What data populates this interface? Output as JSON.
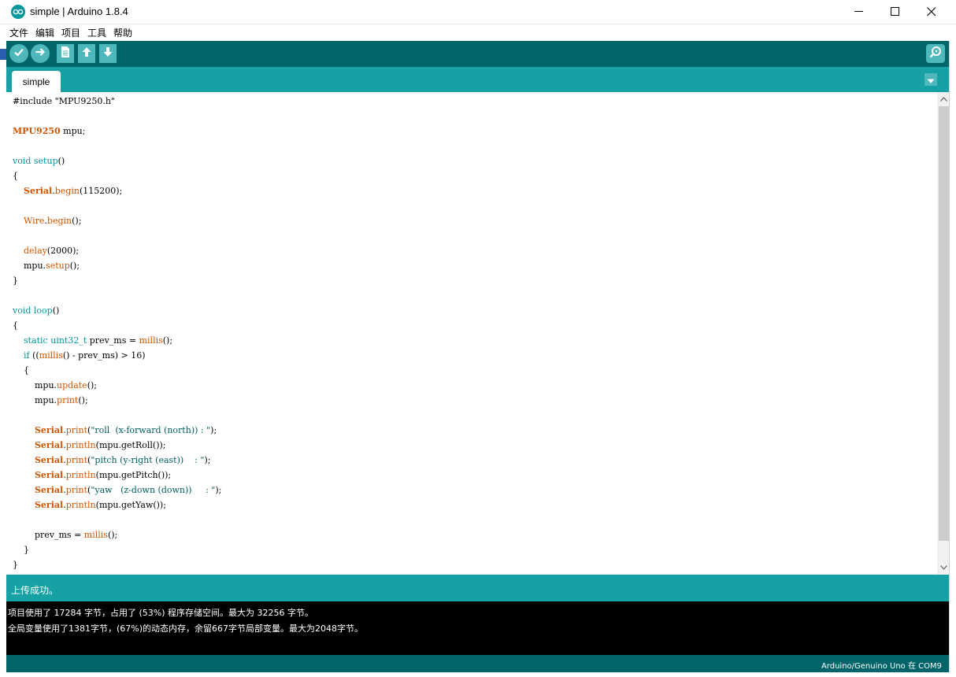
{
  "window": {
    "title": "simple | Arduino 1.8.4"
  },
  "menu": [
    "文件",
    "编辑",
    "项目",
    "工具",
    "帮助"
  ],
  "toolbar": {
    "buttons": [
      "verify-icon",
      "upload-icon",
      "new-icon",
      "open-icon",
      "save-icon"
    ],
    "serial_monitor": "serial-monitor-icon"
  },
  "tabs": [
    "simple"
  ],
  "editor": {
    "lines": [
      [
        [
          "c-pp",
          "#include \"MPU9250.h\""
        ]
      ],
      [],
      [
        [
          "c-cls",
          "MPU9250"
        ],
        [
          "",
          " mpu;"
        ]
      ],
      [],
      [
        [
          "c-kw",
          "void"
        ],
        [
          "",
          " "
        ],
        [
          "c-kw",
          "setup"
        ],
        [
          "",
          "()"
        ]
      ],
      [
        [
          "",
          "{"
        ]
      ],
      [
        [
          "",
          "    "
        ],
        [
          "c-cls",
          "Serial"
        ],
        [
          "",
          "."
        ],
        [
          "c-fn",
          "begin"
        ],
        [
          "",
          "(115200);"
        ]
      ],
      [],
      [
        [
          "",
          "    "
        ],
        [
          "c-fn",
          "Wire"
        ],
        [
          "",
          "."
        ],
        [
          "c-fn",
          "begin"
        ],
        [
          "",
          "();"
        ]
      ],
      [],
      [
        [
          "",
          "    "
        ],
        [
          "c-fn",
          "delay"
        ],
        [
          "",
          "(2000);"
        ]
      ],
      [
        [
          "",
          "    mpu."
        ],
        [
          "c-fn",
          "setup"
        ],
        [
          "",
          "();"
        ]
      ],
      [
        [
          "",
          "}"
        ]
      ],
      [],
      [
        [
          "c-kw",
          "void"
        ],
        [
          "",
          " "
        ],
        [
          "c-kw",
          "loop"
        ],
        [
          "",
          "()"
        ]
      ],
      [
        [
          "",
          "{"
        ]
      ],
      [
        [
          "",
          "    "
        ],
        [
          "c-kw",
          "static"
        ],
        [
          "",
          " "
        ],
        [
          "c-kw",
          "uint32_t"
        ],
        [
          "",
          " prev_ms = "
        ],
        [
          "c-fn",
          "millis"
        ],
        [
          "",
          "();"
        ]
      ],
      [
        [
          "",
          "    "
        ],
        [
          "c-kw",
          "if"
        ],
        [
          "",
          " (("
        ],
        [
          "c-fn",
          "millis"
        ],
        [
          "",
          "() - prev_ms) > 16)"
        ]
      ],
      [
        [
          "",
          "    {"
        ]
      ],
      [
        [
          "",
          "        mpu."
        ],
        [
          "c-fn",
          "update"
        ],
        [
          "",
          "();"
        ]
      ],
      [
        [
          "",
          "        mpu."
        ],
        [
          "c-fn",
          "print"
        ],
        [
          "",
          "();"
        ]
      ],
      [],
      [
        [
          "",
          "        "
        ],
        [
          "c-cls",
          "Serial"
        ],
        [
          "",
          "."
        ],
        [
          "c-fn",
          "print"
        ],
        [
          "",
          "("
        ],
        [
          "c-str",
          "\"roll  (x-forward (north)) : \""
        ],
        [
          "",
          ");"
        ]
      ],
      [
        [
          "",
          "        "
        ],
        [
          "c-cls",
          "Serial"
        ],
        [
          "",
          "."
        ],
        [
          "c-fn",
          "println"
        ],
        [
          "",
          "(mpu.getRoll());"
        ]
      ],
      [
        [
          "",
          "        "
        ],
        [
          "c-cls",
          "Serial"
        ],
        [
          "",
          "."
        ],
        [
          "c-fn",
          "print"
        ],
        [
          "",
          "("
        ],
        [
          "c-str",
          "\"pitch (y-right (east))    : \""
        ],
        [
          "",
          ");"
        ]
      ],
      [
        [
          "",
          "        "
        ],
        [
          "c-cls",
          "Serial"
        ],
        [
          "",
          "."
        ],
        [
          "c-fn",
          "println"
        ],
        [
          "",
          "(mpu.getPitch());"
        ]
      ],
      [
        [
          "",
          "        "
        ],
        [
          "c-cls",
          "Serial"
        ],
        [
          "",
          "."
        ],
        [
          "c-fn",
          "print"
        ],
        [
          "",
          "("
        ],
        [
          "c-str",
          "\"yaw   (z-down (down))     : \""
        ],
        [
          "",
          ");"
        ]
      ],
      [
        [
          "",
          "        "
        ],
        [
          "c-cls",
          "Serial"
        ],
        [
          "",
          "."
        ],
        [
          "c-fn",
          "println"
        ],
        [
          "",
          "(mpu.getYaw());"
        ]
      ],
      [],
      [
        [
          "",
          "        prev_ms = "
        ],
        [
          "c-fn",
          "millis"
        ],
        [
          "",
          "();"
        ]
      ],
      [
        [
          "",
          "    }"
        ]
      ],
      [
        [
          "",
          "}"
        ]
      ]
    ]
  },
  "status": {
    "message": "上传成功。"
  },
  "console": {
    "lines": [
      "项目使用了 17284 字节，占用了 (53%) 程序存储空间。最大为 32256 字节。",
      "全局变量使用了1381字节，(67%)的动态内存，余留667字节局部变量。最大为2048字节。"
    ]
  },
  "footer": {
    "board": "Arduino/Genuino Uno 在 COM9"
  },
  "colors": {
    "toolbar": "#006468",
    "tabbar": "#17a1a5",
    "button": "#4db7bb",
    "keyword": "#00979c",
    "class": "#d35400"
  }
}
